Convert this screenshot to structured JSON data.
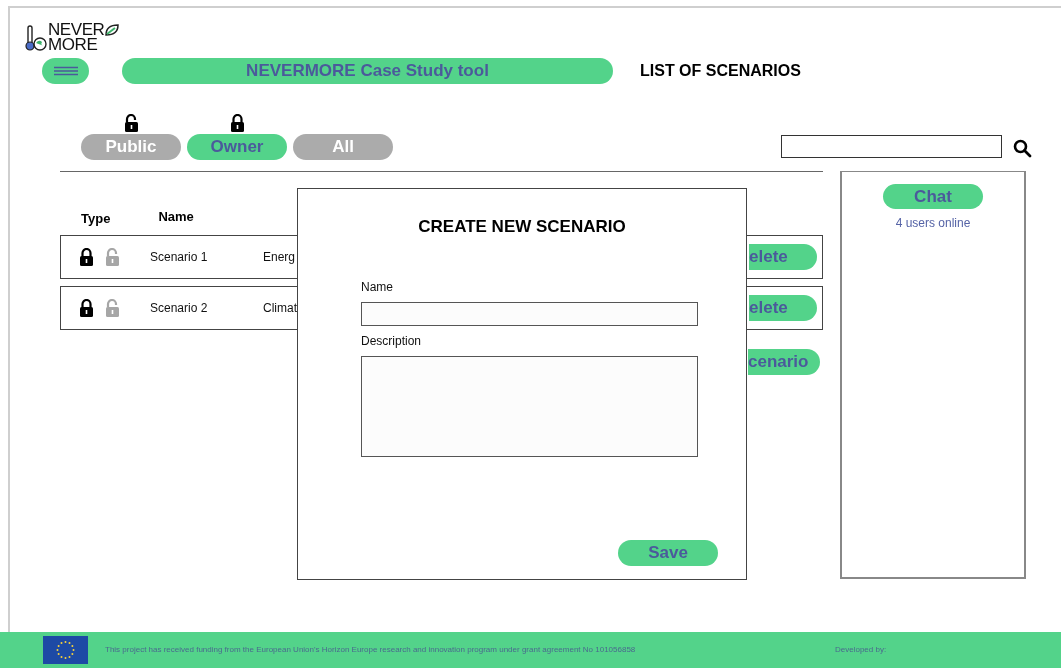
{
  "logo": {
    "line_1": "NEVER",
    "line_2": "MORE"
  },
  "header": {
    "title": "NEVERMORE Case Study tool",
    "heading": "LIST OF SCENARIOS"
  },
  "filter_tabs": [
    {
      "label": "Public",
      "selected": false,
      "locked": false
    },
    {
      "label": "Owner",
      "selected": true,
      "locked": true
    },
    {
      "label": "All",
      "selected": false
    }
  ],
  "table": {
    "columns": [
      "Type",
      "Name"
    ],
    "rows": [
      {
        "locked": true,
        "name": "Scenario 1",
        "column_3": "Energ",
        "action": "elete"
      },
      {
        "locked": true,
        "name": "Scenario 2",
        "column_3": "Climat",
        "action": "elete"
      }
    ]
  },
  "new_button": "cenario",
  "chat": {
    "button": "Chat",
    "status": "4 users online"
  },
  "dialog": {
    "title": "CREATE NEW SCENARIO",
    "fields": [
      {
        "label": "Name",
        "kind": "input"
      },
      {
        "label": "Description",
        "kind": "textarea"
      }
    ],
    "button": "Save"
  },
  "footer": {
    "funding": "This project has received funding from the European Union's Horizon Europe research and innovation program under grant agreement No 101056858",
    "developed_by": "Developed by:"
  }
}
